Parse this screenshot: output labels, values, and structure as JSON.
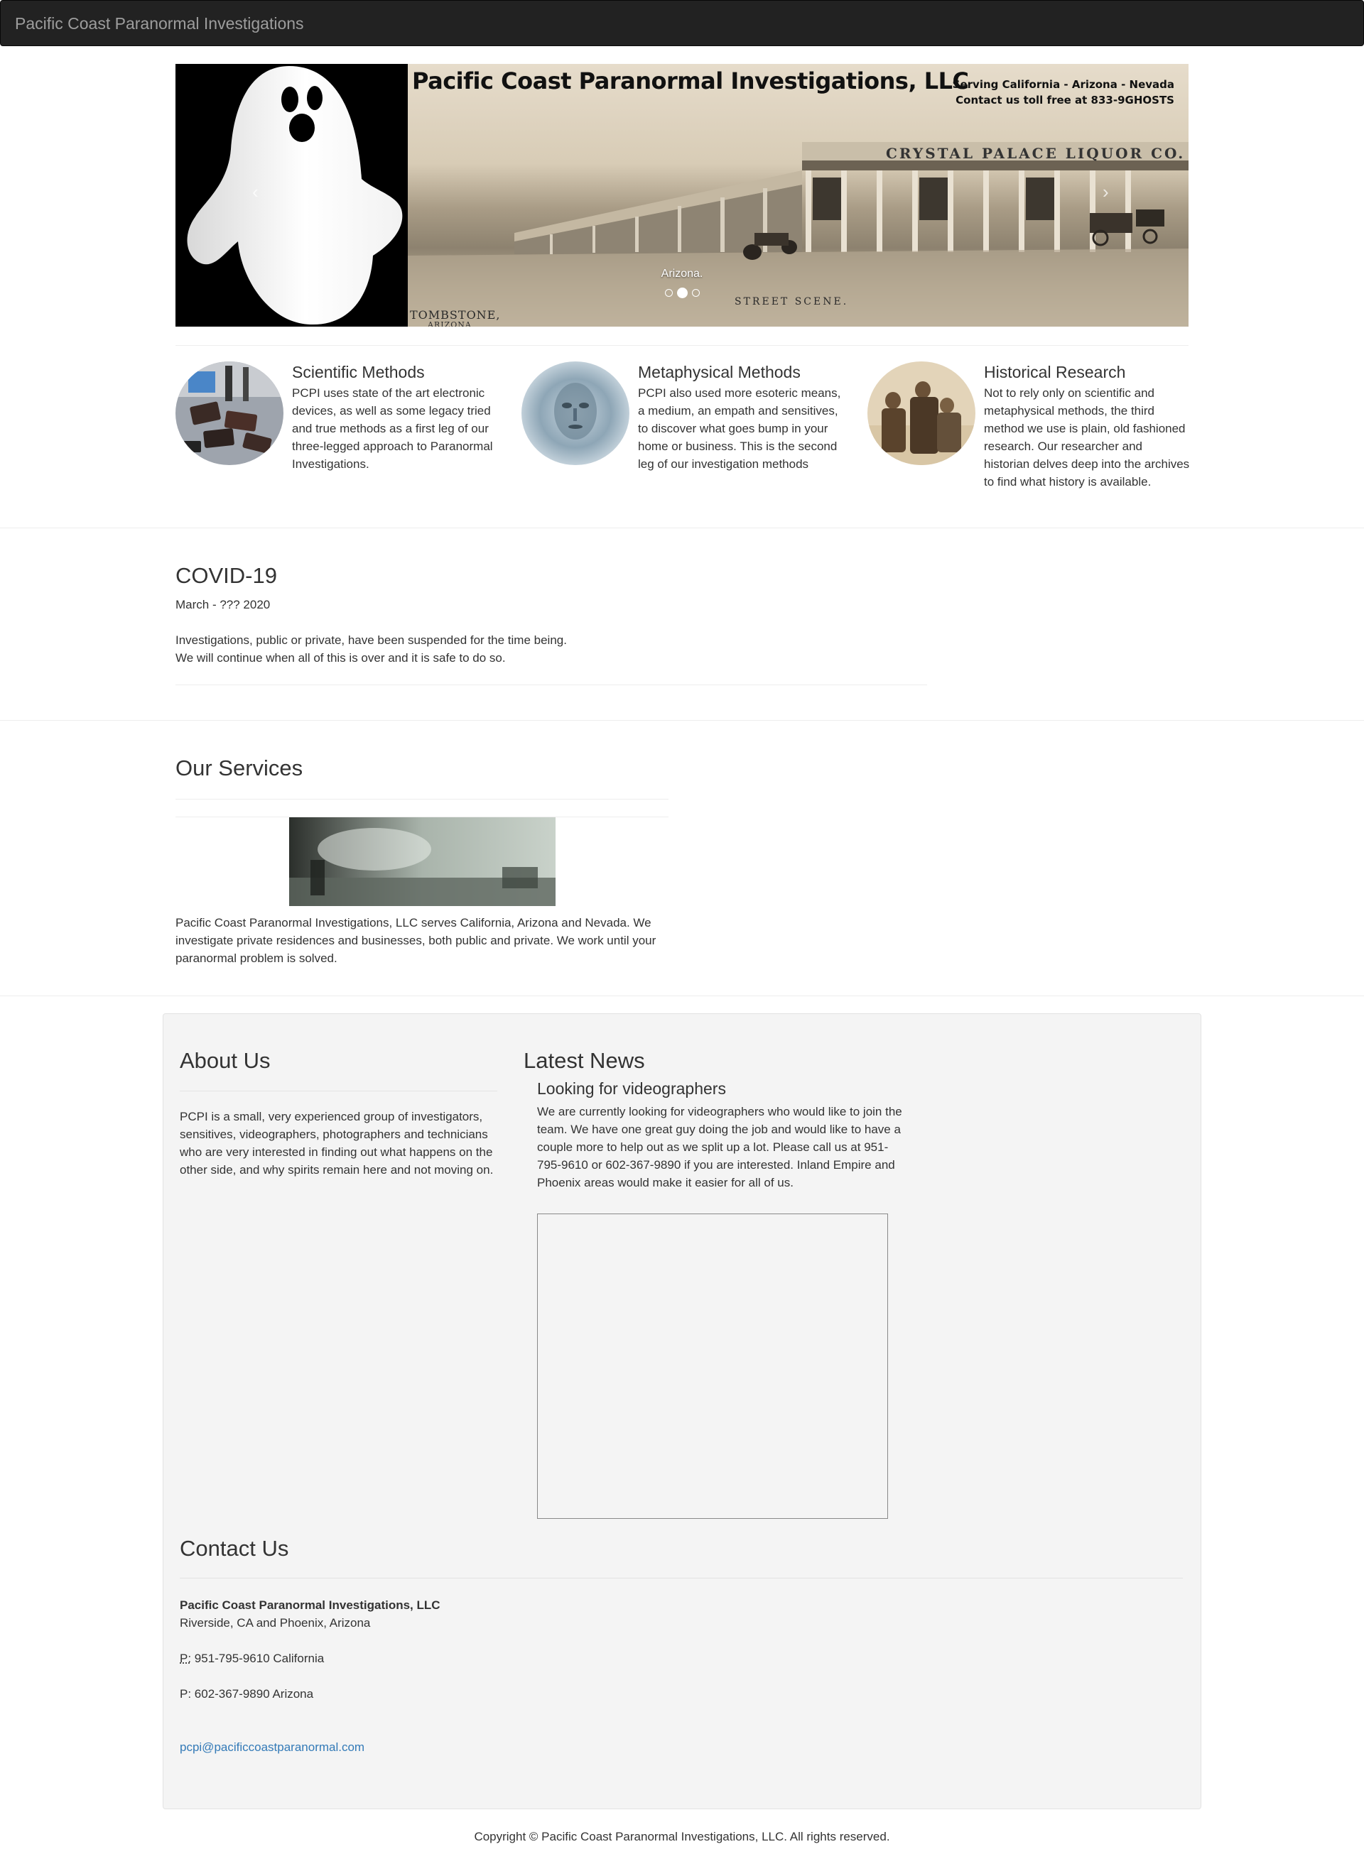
{
  "navbar": {
    "brand": "Pacific Coast Paranormal Investigations"
  },
  "carousel": {
    "banner_title": "Pacific Coast Paranormal Investigations, LLC",
    "banner_line1": "Serving California - Arizona - Nevada",
    "banner_line2": "Contact us toll free at 833-9GHOSTS",
    "store_sign": "CRYSTAL PALACE LIQUOR CO.",
    "street_scene": "STREET SCENE.",
    "tombstone": "TOMBSTONE,",
    "tombstone_state": "ARIZONA",
    "caption": "Arizona.",
    "prev_icon": "chevron-left-icon",
    "next_icon": "chevron-right-icon",
    "slides_count_visible": 3,
    "active_slide": 2
  },
  "features": [
    {
      "title": "Scientific Methods",
      "text": "PCPI uses state of the art electronic devices, as well as some legacy tried and true methods as a first leg of our three-legged approach to Paranormal Investigations."
    },
    {
      "title": "Metaphysical Methods",
      "text": "PCPI also used more esoteric means, a medium, an empath and sensitives, to discover what goes bump in your home or business. This is the second leg of our investigation methods"
    },
    {
      "title": "Historical Research",
      "text": "Not to rely only on scientific and metaphysical methods, the third method we use is plain, old fashioned research. Our researcher and historian delves deep into the archives to find what history is available."
    }
  ],
  "covid": {
    "title": "COVID-19",
    "dates": "March - ??? 2020",
    "line1": "Investigations, public or private, have been suspended for the time being.",
    "line2": "We will continue when all of this is over and it is safe to do so."
  },
  "services": {
    "title": "Our Services",
    "text": "Pacific Coast Paranormal Investigations, LLC serves California, Arizona and Nevada. We investigate private residences and businesses, both public and private. We work until your paranormal problem is solved."
  },
  "about": {
    "title": "About Us",
    "text": "PCPI is a small, very experienced group of investigators, sensitives, videographers, photographers and technicians who are very interested in finding out what happens on the other side, and why spirits remain here and not moving on."
  },
  "news": {
    "title": "Latest News",
    "item_title": "Looking for videographers",
    "item_text": "We are currently looking for videographers who would like to join the team. We have one great guy doing the job and would like to have a couple more to help out as we split up a lot. Please call us at 951-795-9610 or 602-367-9890 if you are interested. Inland Empire and Phoenix areas would make it easier for all of us."
  },
  "contact": {
    "title": "Contact Us",
    "company": "Pacific Coast Paranormal Investigations, LLC",
    "location": "Riverside, CA and Phoenix, Arizona",
    "phone1_label": "P:",
    "phone1": " 951-795-9610 California",
    "phone2": "P: 602-367-9890 Arizona",
    "email": "pcpi@pacificcoastparanormal.com"
  },
  "footer": {
    "copyright": "Copyright © Pacific Coast Paranormal Investigations, LLC. All rights reserved."
  },
  "colors": {
    "navbar": "#222222",
    "brand_text": "#9d9d9d",
    "link": "#337ab7",
    "panel": "#f4f4f4"
  }
}
